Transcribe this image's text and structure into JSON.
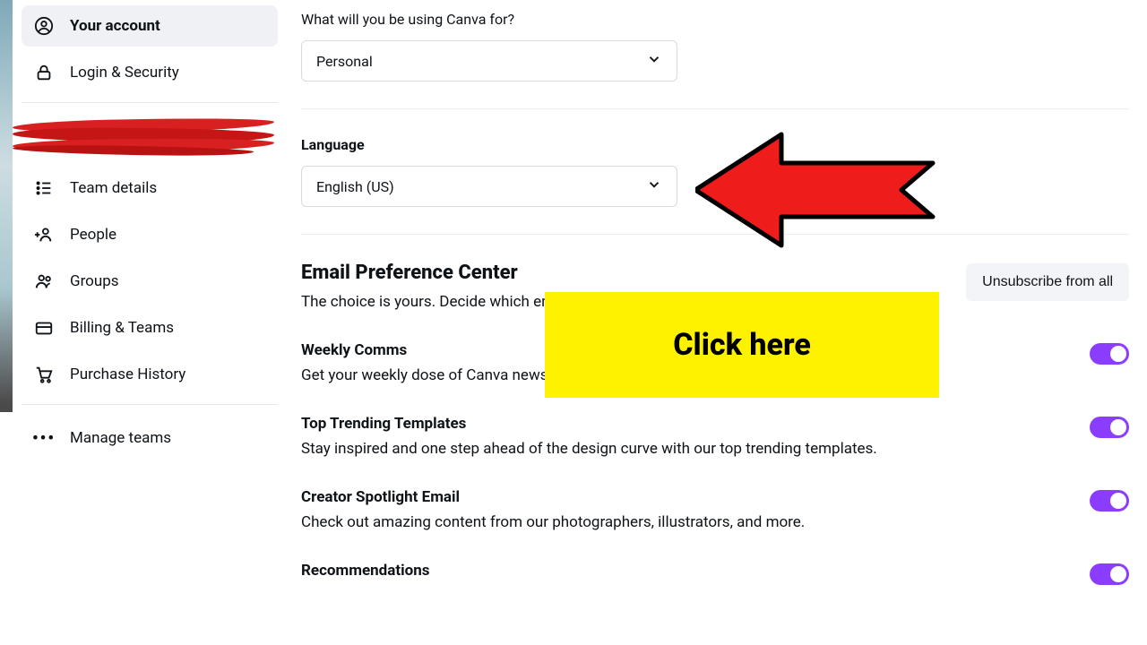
{
  "sidebar": {
    "items": [
      {
        "label": "Your account"
      },
      {
        "label": "Login & Security"
      },
      {
        "label": "Team details"
      },
      {
        "label": "People"
      },
      {
        "label": "Groups"
      },
      {
        "label": "Billing & Teams"
      },
      {
        "label": "Purchase History"
      },
      {
        "label": "Manage teams"
      }
    ]
  },
  "usage": {
    "label": "What will you be using Canva for?",
    "value": "Personal"
  },
  "language": {
    "label": "Language",
    "value": "English (US)"
  },
  "email_pref": {
    "title": "Email Preference Center",
    "subtitle": "The choice is yours. Decide which emails you'd like to receive.",
    "unsubscribe": "Unsubscribe from all",
    "items": [
      {
        "title": "Weekly Comms",
        "desc": "Get your weekly dose of Canva news and learn with our handy design tips."
      },
      {
        "title": "Top Trending Templates",
        "desc": "Stay inspired and one step ahead of the design curve with our top trending templates."
      },
      {
        "title": "Creator Spotlight Email",
        "desc": "Check out amazing content from our photographers, illustrators, and more."
      },
      {
        "title": "Recommendations",
        "desc": ""
      }
    ]
  },
  "annotation": {
    "callout": "Click here"
  }
}
